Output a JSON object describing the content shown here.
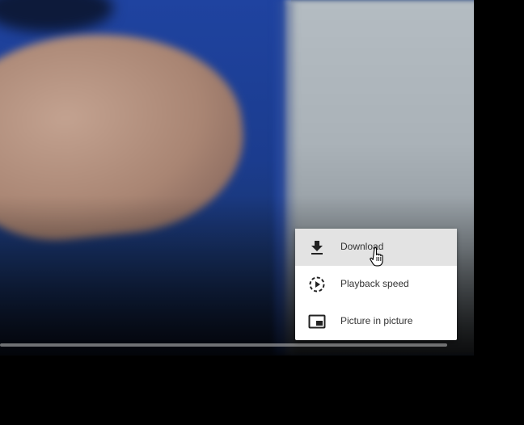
{
  "menu": {
    "items": [
      {
        "label": "Download",
        "icon": "download-icon",
        "hovered": true
      },
      {
        "label": "Playback speed",
        "icon": "playback-speed-icon",
        "hovered": false
      },
      {
        "label": "Picture in picture",
        "icon": "picture-in-picture-icon",
        "hovered": false
      }
    ]
  },
  "colors": {
    "menu_background": "#ffffff",
    "menu_hover": "#e3e3e3",
    "menu_text": "#333333",
    "page_background": "#000000"
  }
}
